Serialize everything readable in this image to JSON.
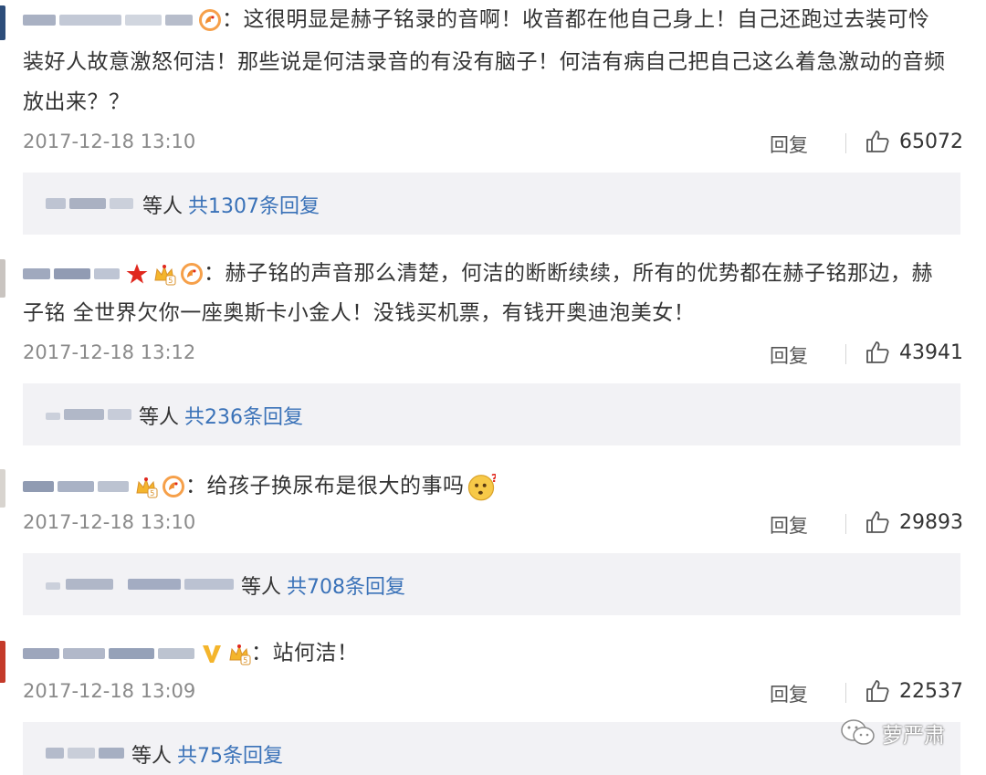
{
  "comments": [
    {
      "text_lines": [
        "：这很明显是赫子铭录的音啊！收音都在他自己身上！自己还跑过去装可怜",
        "装好人故意激怒何洁！那些说是何洁录音的有没有脑子！何洁有病自己把自己这么着急激动的音频",
        "放出来？？"
      ],
      "time": "2017-12-18 13:10",
      "reply_label": "回复",
      "likes": "65072",
      "reply_summary": {
        "etc": "等人",
        "total": "共1307条回复"
      }
    },
    {
      "text_lines": [
        "：赫子铭的声音那么清楚，何洁的断断续续，所有的优势都在赫子铭那边，赫",
        "子铭 全世界欠你一座奥斯卡小金人！没钱买机票，有钱开奥迪泡美女！"
      ],
      "time": "2017-12-18 13:12",
      "reply_label": "回复",
      "likes": "43941",
      "reply_summary": {
        "etc": "等人",
        "total": "共236条回复"
      }
    },
    {
      "text_lines": [
        "：给孩子换尿布是很大的事吗"
      ],
      "time": "2017-12-18 13:10",
      "reply_label": "回复",
      "likes": "29893",
      "reply_summary": {
        "etc": "等人",
        "total": "共708条回复"
      }
    },
    {
      "text_lines": [
        "：站何洁！"
      ],
      "time": "2017-12-18 13:09",
      "reply_label": "回复",
      "likes": "22537",
      "reply_summary": {
        "etc": "等人",
        "total": "共75条回复"
      }
    }
  ],
  "icons": {
    "like": "thumbs-up-icon",
    "phoenix_badge": "phoenix-badge-icon",
    "crown_badge": "crown-badge-icon",
    "star_badge": "red-star-icon",
    "verified_badge": "verified-v-icon",
    "confused_emoji": "confused-face-emoji-icon"
  },
  "colors": {
    "link_blue": "#3a72b8",
    "badge_orange": "#f08c30",
    "star_red": "#e0281e",
    "reply_bg": "#f2f2f5",
    "meta_gray": "#8a8a8a"
  },
  "watermark": {
    "text": "萝严肃",
    "icon": "wechat-icon"
  }
}
